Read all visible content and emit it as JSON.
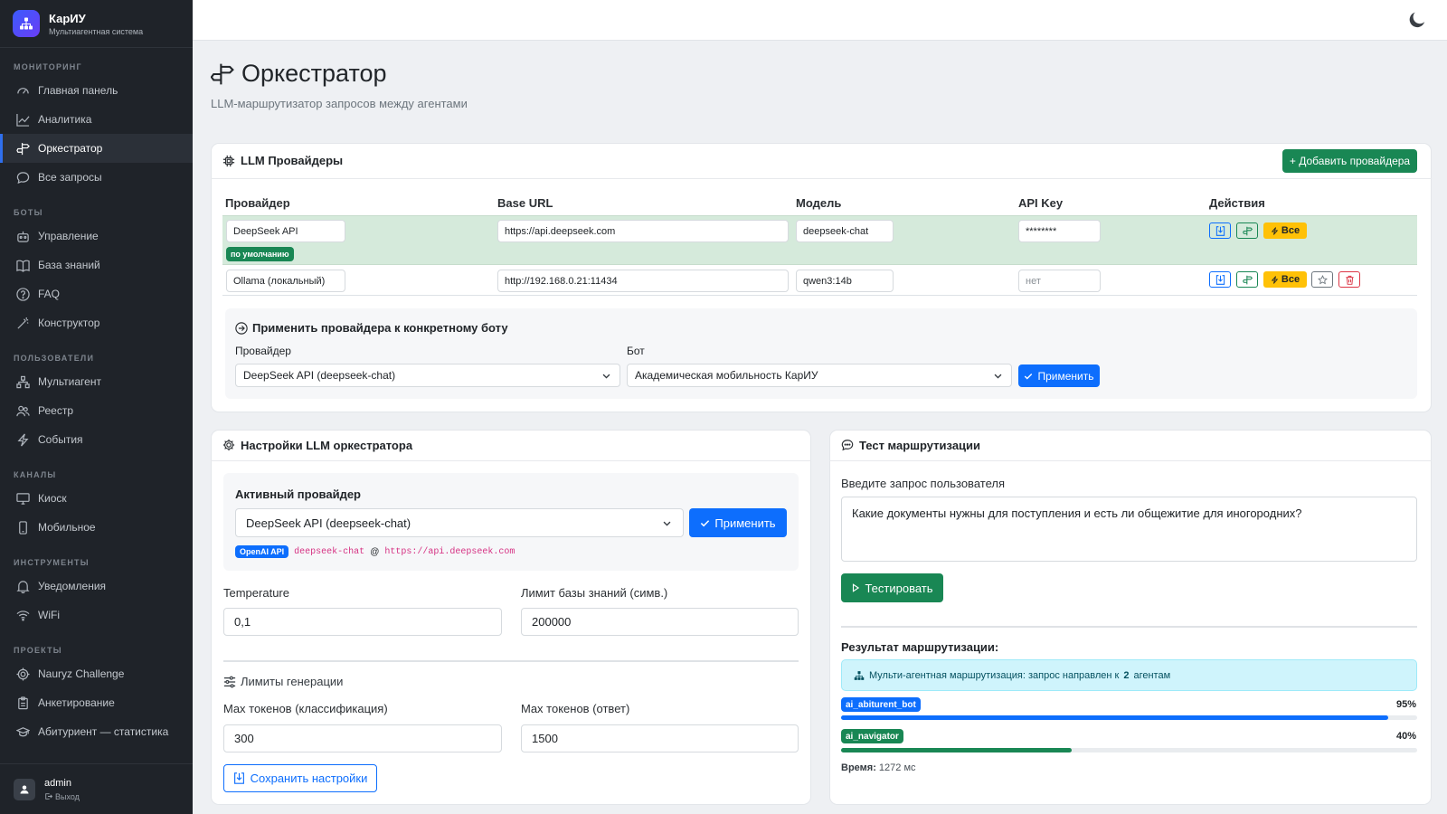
{
  "app": {
    "name": "КарИУ",
    "subtitle": "Мультиагентная система"
  },
  "sidebar": {
    "sections": [
      {
        "title": "МОНИТОРИНГ",
        "items": [
          {
            "label": "Главная панель",
            "icon": "speedometer-icon"
          },
          {
            "label": "Аналитика",
            "icon": "chart-line-icon"
          },
          {
            "label": "Оркестратор",
            "icon": "signpost-icon",
            "active": true
          },
          {
            "label": "Все запросы",
            "icon": "chat-icon"
          }
        ]
      },
      {
        "title": "БОТЫ",
        "items": [
          {
            "label": "Управление",
            "icon": "robot-icon"
          },
          {
            "label": "База знаний",
            "icon": "book-icon"
          },
          {
            "label": "FAQ",
            "icon": "question-circle-icon"
          },
          {
            "label": "Конструктор",
            "icon": "magic-wand-icon"
          }
        ]
      },
      {
        "title": "ПОЛЬЗОВАТЕЛИ",
        "items": [
          {
            "label": "Мультиагент",
            "icon": "diagram-icon"
          },
          {
            "label": "Реестр",
            "icon": "people-icon"
          },
          {
            "label": "События",
            "icon": "lightning-icon"
          }
        ]
      },
      {
        "title": "КАНАЛЫ",
        "items": [
          {
            "label": "Киоск",
            "icon": "monitor-icon"
          },
          {
            "label": "Мобильное",
            "icon": "phone-icon"
          }
        ]
      },
      {
        "title": "ИНСТРУМЕНТЫ",
        "items": [
          {
            "label": "Уведомления",
            "icon": "bell-icon"
          },
          {
            "label": "WiFi",
            "icon": "wifi-icon"
          }
        ]
      },
      {
        "title": "ПРОЕКТЫ",
        "items": [
          {
            "label": "Nauryz Challenge",
            "icon": "gear-icon"
          },
          {
            "label": "Анкетирование",
            "icon": "clipboard-icon"
          },
          {
            "label": "Абитуриент — статистика",
            "icon": "graduation-icon"
          }
        ]
      }
    ],
    "user": {
      "name": "admin",
      "logout": "Выход"
    }
  },
  "page": {
    "title": "Оркестратор",
    "subtitle": "LLM-маршрутизатор запросов между агентами"
  },
  "providers": {
    "title": "LLM Провайдеры",
    "add_button": "+ Добавить провайдера",
    "columns": [
      "Провайдер",
      "Base URL",
      "Модель",
      "API Key",
      "Действия"
    ],
    "rows": [
      {
        "name": "DeepSeek API",
        "url": "https://api.deepseek.com",
        "model": "deepseek-chat",
        "key": "********",
        "default_badge": "по умолчанию",
        "all_label": "Все"
      },
      {
        "name": "Ollama (локальный)",
        "url": "http://192.168.0.21:11434",
        "model": "qwen3:14b",
        "key_placeholder": "нет",
        "all_label": "Все"
      }
    ],
    "apply": {
      "title": "Применить провайдера к конкретному боту",
      "provider_label": "Провайдер",
      "provider_value": "DeepSeek API (deepseek-chat)",
      "bot_label": "Бот",
      "bot_value": "Академическая мобильность КарИУ",
      "button": "Применить"
    }
  },
  "settings": {
    "title": "Настройки LLM оркестратора",
    "active_provider_label": "Активный провайдер",
    "active_provider_value": "DeepSeek API (deepseek-chat)",
    "apply_button": "Применить",
    "api_badge": "OpenAI API",
    "model_code": "deepseek-chat",
    "at": "@",
    "url_code": "https://api.deepseek.com",
    "temperature_label": "Temperature",
    "temperature_value": "0,1",
    "kb_limit_label": "Лимит базы знаний (симв.)",
    "kb_limit_value": "200000",
    "gen_limits_title": "Лимиты генерации",
    "max_cls_label": "Max токенов (классификация)",
    "max_cls_value": "300",
    "max_ans_label": "Max токенов (ответ)",
    "max_ans_value": "1500",
    "save_button": "Сохранить настройки"
  },
  "routing": {
    "title": "Тест маршрутизации",
    "query_label": "Введите запрос пользователя",
    "query_value": "Какие документы нужны для поступления и есть ли общежитие для иногородних?",
    "test_button": "Тестировать",
    "result_label": "Результат маршрутизации:",
    "info_text": "Мульти-агентная маршрутизация: запрос направлен к",
    "info_count": "2",
    "info_suffix": "агентам",
    "agents": [
      {
        "name": "ai_abiturent_bot",
        "percent_label": "95%",
        "value": 0.95,
        "color": "#0d6efd"
      },
      {
        "name": "ai_navigator",
        "percent_label": "40%",
        "value": 0.4,
        "color": "#198754"
      }
    ],
    "time_label": "Время:",
    "time_value": "1272 мс"
  },
  "colors": {
    "primary": "#0d6efd",
    "success": "#198754",
    "warning": "#ffc107",
    "danger": "#dc3545",
    "sidebar": "#1f2329",
    "default_row": "#d5eadb",
    "info": "#cff4fc"
  }
}
